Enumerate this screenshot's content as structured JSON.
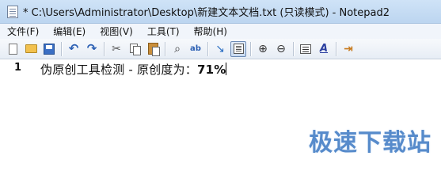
{
  "window": {
    "title": "* C:\\Users\\Administrator\\Desktop\\新建文本文档.txt (只读模式) - Notepad2",
    "icon": "notepad-icon"
  },
  "menu": {
    "items": [
      "文件(F)",
      "编辑(E)",
      "视图(V)",
      "工具(T)",
      "帮助(H)"
    ]
  },
  "toolbar": {
    "buttons": [
      {
        "name": "new-file-icon"
      },
      {
        "name": "open-folder-icon"
      },
      {
        "name": "save-icon"
      },
      {
        "name": "undo-icon"
      },
      {
        "name": "redo-icon"
      },
      {
        "name": "cut-icon"
      },
      {
        "name": "copy-icon"
      },
      {
        "name": "paste-icon"
      },
      {
        "name": "find-icon"
      },
      {
        "name": "replace-icon"
      },
      {
        "name": "word-wrap-icon"
      },
      {
        "name": "view-whitespace-icon",
        "active": true
      },
      {
        "name": "zoom-in-icon"
      },
      {
        "name": "zoom-out-icon"
      },
      {
        "name": "scheme-icon"
      },
      {
        "name": "font-icon"
      },
      {
        "name": "exit-icon"
      }
    ]
  },
  "editor": {
    "line_number": "1",
    "text_main": "伪原创工具检测 - 原创度为：",
    "text_value": "71%"
  },
  "watermark": {
    "text": "极速下载站"
  },
  "colors": {
    "titlebar": "#c4dbf3",
    "menubar": "#f1f5fb",
    "watermark": "#3a77c2"
  }
}
